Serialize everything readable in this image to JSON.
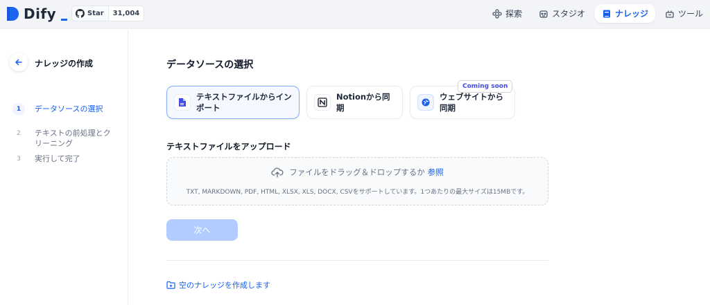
{
  "header": {
    "app_name": "Dify",
    "github": {
      "star_label": "Star",
      "star_count": "31,004"
    },
    "nav": [
      {
        "label": "探索",
        "icon": "explore-icon"
      },
      {
        "label": "スタジオ",
        "icon": "robot-icon"
      },
      {
        "label": "ナレッジ",
        "icon": "book-icon",
        "active": true
      },
      {
        "label": "ツール",
        "icon": "tools-icon"
      }
    ]
  },
  "sidebar": {
    "title": "ナレッジの作成",
    "steps": [
      {
        "num": "1",
        "label": "データソースの選択",
        "active": true
      },
      {
        "num": "2",
        "label": "テキストの前処理とクリーニング"
      },
      {
        "num": "3",
        "label": "実行して完了"
      }
    ]
  },
  "main": {
    "section_title": "データソースの選択",
    "sources": [
      {
        "label": "テキストファイルからインポート",
        "icon": "file-icon",
        "active": true
      },
      {
        "label": "Notionから同期",
        "icon": "notion-icon"
      },
      {
        "label": "ウェブサイトから同期",
        "icon": "website-icon",
        "badge": "Coming soon"
      }
    ],
    "upload": {
      "title": "テキストファイルをアップロード",
      "drop_text": "ファイルをドラッグ＆ドロップするか",
      "browse_link": "参照",
      "supported": "TXT, MARKDOWN, PDF, HTML, XLSX, XLS, DOCX, CSVをサポートしています。1つあたりの最大サイズは15MBです。"
    },
    "next_label": "次へ",
    "create_empty_label": "空のナレッジを作成します"
  },
  "colors": {
    "accent": "#155eef",
    "disabled_button": "#b2ccff",
    "badge_text": "#444ce7"
  }
}
